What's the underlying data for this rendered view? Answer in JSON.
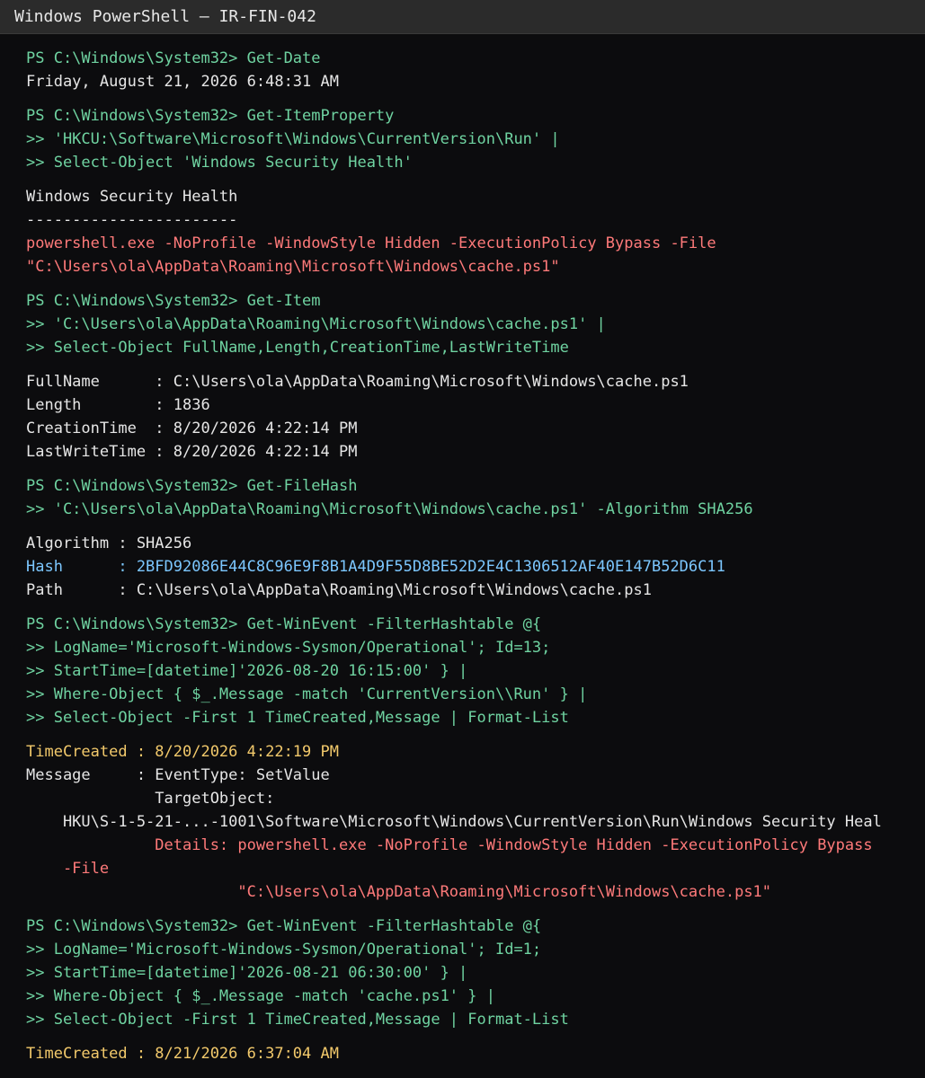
{
  "window": {
    "title": "Windows PowerShell — IR-FIN-042"
  },
  "colors": {
    "prompt": "#6fd3a1",
    "output": "#e6e6e6",
    "alert": "#ff7a7a",
    "hash": "#7cc7ff",
    "time": "#f2c96b"
  },
  "blocks": [
    {
      "lines": [
        {
          "style": "prompt",
          "text": "PS C:\\Windows\\System32> Get-Date"
        },
        {
          "style": "out",
          "text": "Friday, August 21, 2026 6:48:31 AM"
        }
      ]
    },
    {
      "lines": [
        {
          "style": "prompt",
          "text": "PS C:\\Windows\\System32> Get-ItemProperty"
        },
        {
          "style": "cmd",
          "text": ">> 'HKCU:\\Software\\Microsoft\\Windows\\CurrentVersion\\Run' |"
        },
        {
          "style": "cmd",
          "text": ">> Select-Object 'Windows Security Health'"
        }
      ]
    },
    {
      "lines": [
        {
          "style": "out",
          "text": "Windows Security Health"
        },
        {
          "style": "out",
          "text": "-----------------------"
        },
        {
          "style": "alert",
          "text": "powershell.exe -NoProfile -WindowStyle Hidden -ExecutionPolicy Bypass -File"
        },
        {
          "style": "alert",
          "text": "\"C:\\Users\\ola\\AppData\\Roaming\\Microsoft\\Windows\\cache.ps1\""
        }
      ]
    },
    {
      "lines": [
        {
          "style": "prompt",
          "text": "PS C:\\Windows\\System32> Get-Item"
        },
        {
          "style": "cmd",
          "text": ">> 'C:\\Users\\ola\\AppData\\Roaming\\Microsoft\\Windows\\cache.ps1' |"
        },
        {
          "style": "cmd",
          "text": ">> Select-Object FullName,Length,CreationTime,LastWriteTime"
        }
      ]
    },
    {
      "lines": [
        {
          "style": "out",
          "text": "FullName      : C:\\Users\\ola\\AppData\\Roaming\\Microsoft\\Windows\\cache.ps1"
        },
        {
          "style": "out",
          "text": "Length        : 1836"
        },
        {
          "style": "out",
          "text": "CreationTime  : 8/20/2026 4:22:14 PM"
        },
        {
          "style": "out",
          "text": "LastWriteTime : 8/20/2026 4:22:14 PM"
        }
      ]
    },
    {
      "lines": [
        {
          "style": "prompt",
          "text": "PS C:\\Windows\\System32> Get-FileHash"
        },
        {
          "style": "cmd",
          "text": ">> 'C:\\Users\\ola\\AppData\\Roaming\\Microsoft\\Windows\\cache.ps1' -Algorithm SHA256"
        }
      ]
    },
    {
      "lines": [
        {
          "style": "out",
          "text": "Algorithm : SHA256"
        },
        {
          "style": "hash",
          "text": "Hash      : 2BFD92086E44C8C96E9F8B1A4D9F55D8BE52D2E4C1306512AF40E147B52D6C11"
        },
        {
          "style": "out",
          "text": "Path      : C:\\Users\\ola\\AppData\\Roaming\\Microsoft\\Windows\\cache.ps1"
        }
      ]
    },
    {
      "lines": [
        {
          "style": "prompt",
          "text": "PS C:\\Windows\\System32> Get-WinEvent -FilterHashtable @{"
        },
        {
          "style": "cmd",
          "text": ">> LogName='Microsoft-Windows-Sysmon/Operational'; Id=13;"
        },
        {
          "style": "cmd",
          "text": ">> StartTime=[datetime]'2026-08-20 16:15:00' } |"
        },
        {
          "style": "cmd",
          "text": ">> Where-Object { $_.Message -match 'CurrentVersion\\\\Run' } |"
        },
        {
          "style": "cmd",
          "text": ">> Select-Object -First 1 TimeCreated,Message | Format-List"
        }
      ]
    },
    {
      "lines": [
        {
          "style": "time",
          "text": "TimeCreated : 8/20/2026 4:22:19 PM"
        },
        {
          "style": "out",
          "text": "Message     : EventType: SetValue"
        },
        {
          "style": "out",
          "text": "              TargetObject:"
        },
        {
          "style": "out",
          "text": "    HKU\\S-1-5-21-...-1001\\Software\\Microsoft\\Windows\\CurrentVersion\\Run\\Windows Security Heal"
        },
        {
          "style": "alert",
          "text": "              Details: powershell.exe -NoProfile -WindowStyle Hidden -ExecutionPolicy Bypass"
        },
        {
          "style": "alert",
          "text": "    -File"
        },
        {
          "style": "alert",
          "text": "                       \"C:\\Users\\ola\\AppData\\Roaming\\Microsoft\\Windows\\cache.ps1\""
        }
      ]
    },
    {
      "lines": [
        {
          "style": "prompt",
          "text": "PS C:\\Windows\\System32> Get-WinEvent -FilterHashtable @{"
        },
        {
          "style": "cmd",
          "text": ">> LogName='Microsoft-Windows-Sysmon/Operational'; Id=1;"
        },
        {
          "style": "cmd",
          "text": ">> StartTime=[datetime]'2026-08-21 06:30:00' } |"
        },
        {
          "style": "cmd",
          "text": ">> Where-Object { $_.Message -match 'cache.ps1' } |"
        },
        {
          "style": "cmd",
          "text": ">> Select-Object -First 1 TimeCreated,Message | Format-List"
        }
      ]
    },
    {
      "lines": [
        {
          "style": "time",
          "text": "TimeCreated : 8/21/2026 6:37:04 AM"
        }
      ]
    }
  ]
}
